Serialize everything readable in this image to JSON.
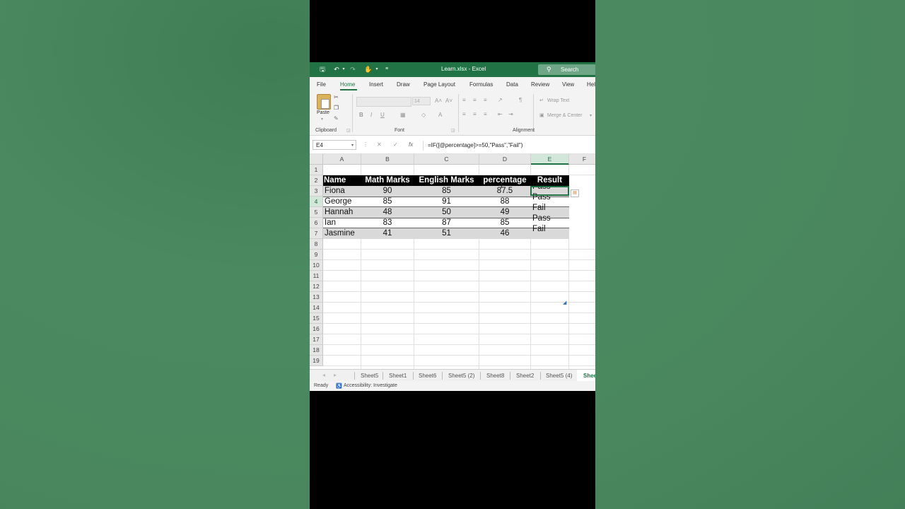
{
  "title_bar": {
    "file_title": "Learn.xlsx  -  Excel",
    "search_label": "Search"
  },
  "ribbon_tabs": [
    "File",
    "Home",
    "Insert",
    "Draw",
    "Page Layout",
    "Formulas",
    "Data",
    "Review",
    "View",
    "Hel"
  ],
  "ribbon": {
    "paste_label": "Paste",
    "font_size": "14",
    "wrap_text": "Wrap Text",
    "merge_center": "Merge & Center",
    "groups": [
      "Clipboard",
      "Font",
      "Alignment"
    ]
  },
  "formula_bar": {
    "name_box": "E4",
    "formula": "=IF([@percentage]>=50,\"Pass\",\"Fail\")"
  },
  "columns": [
    "A",
    "B",
    "C",
    "D",
    "E",
    "F"
  ],
  "rows": [
    "1",
    "2",
    "3",
    "4",
    "5",
    "6",
    "7",
    "8",
    "9",
    "10",
    "11",
    "12",
    "13",
    "14",
    "15",
    "16",
    "17",
    "18",
    "19"
  ],
  "table": {
    "headers": [
      "Name",
      "Math Marks",
      "English Marks",
      "percentage",
      "Result"
    ],
    "rows": [
      [
        "Fiona",
        "90",
        "85",
        "87.5",
        "Pass"
      ],
      [
        "George",
        "85",
        "91",
        "88",
        "Pass"
      ],
      [
        "Hannah",
        "48",
        "50",
        "49",
        "Fail"
      ],
      [
        "Ian",
        "83",
        "87",
        "85",
        "Pass"
      ],
      [
        "Jasmine",
        "41",
        "51",
        "46",
        "Fail"
      ]
    ]
  },
  "sheet_tabs": [
    "Sheet5",
    "Sheet1",
    "Sheet6",
    "Sheet5 (2)",
    "Sheet8",
    "Sheet2",
    "Sheet5 (4)",
    "Shee"
  ],
  "status_bar": {
    "ready": "Ready",
    "accessibility": "Accessibility: Investigate"
  },
  "colors": {
    "excel_green": "#217346",
    "table_header_bg": "#000000",
    "band_gray": "#d9d9d9"
  }
}
